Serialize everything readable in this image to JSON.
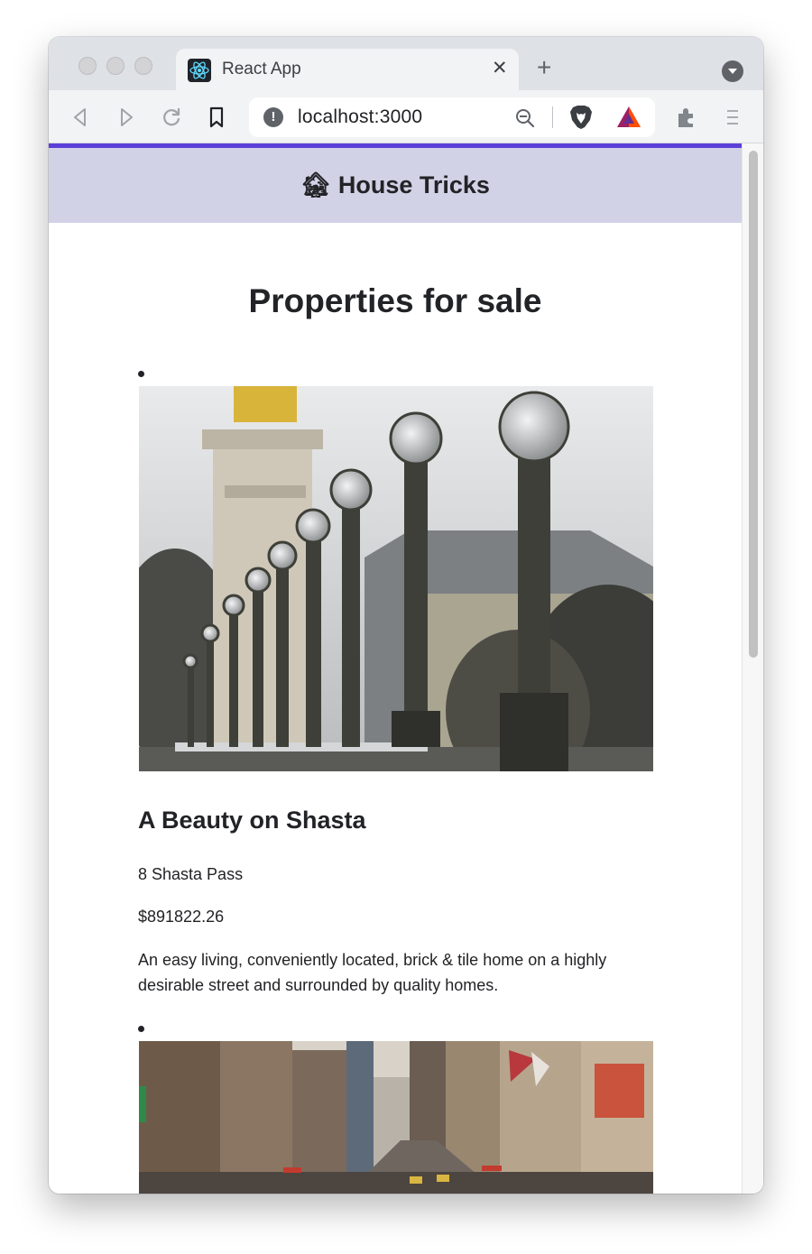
{
  "browser": {
    "tab_title": "React App",
    "tab_close": "✕",
    "new_tab": "+",
    "url": "localhost:3000",
    "info_glyph": "!"
  },
  "icons": {
    "back": "back-arrow-icon",
    "forward": "forward-arrow-icon",
    "reload": "reload-icon",
    "bookmark": "bookmark-icon",
    "zoom": "zoom-out-icon",
    "brave": "brave-lion-icon",
    "rewards": "brave-rewards-triangle-icon",
    "extensions": "puzzle-piece-icon",
    "menu": "hamburger-menu-icon"
  },
  "app": {
    "brand_emoji": "🏚",
    "brand_name": "House Tricks",
    "page_title": "Properties for sale",
    "accent_color": "#5b3fd9",
    "header_bg": "#d1d2e6"
  },
  "properties": [
    {
      "photo": "ornate-street-lamps-bridge-photo",
      "name": "A Beauty on Shasta",
      "address": "8 Shasta Pass",
      "price": "$891822.26",
      "description": "An easy living, conveniently located, brick & tile home on a highly desirable street and surrounded by quality homes."
    },
    {
      "photo": "city-avenue-with-flags-photo"
    }
  ]
}
